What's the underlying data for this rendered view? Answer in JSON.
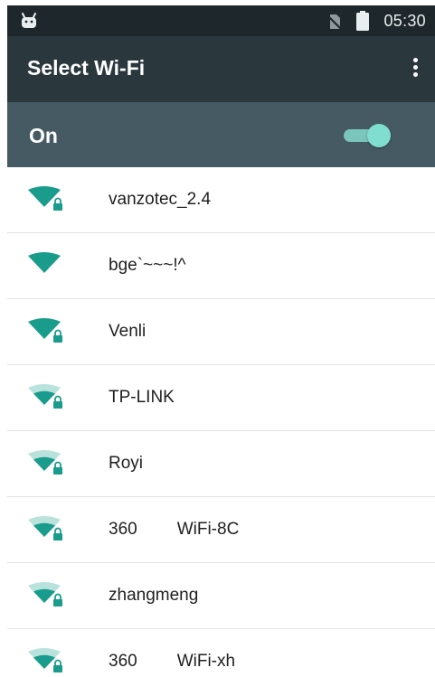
{
  "status_bar": {
    "time": "05:30",
    "icons": [
      "android-icon",
      "no-sim-icon",
      "battery-icon"
    ]
  },
  "app_bar": {
    "title": "Select Wi-Fi",
    "menu_icon": "overflow-menu-icon"
  },
  "wifi_switch": {
    "label": "On",
    "state": "on"
  },
  "colors": {
    "status_bar": "#1e272b",
    "app_bar": "#2a373d",
    "switch_bar": "#465a63",
    "accent": "#1a9c8c",
    "accent_light": "#b9e2dc"
  },
  "networks": [
    {
      "ssid": "vanzotec_2.4",
      "secured": true,
      "signal_bars": 4
    },
    {
      "ssid": "bge`~~~!^",
      "secured": false,
      "signal_bars": 4
    },
    {
      "ssid": "Venli",
      "secured": true,
      "signal_bars": 4
    },
    {
      "ssid": "TP-LINK",
      "secured": true,
      "signal_bars": 2
    },
    {
      "ssid": "Royi",
      "secured": true,
      "signal_bars": 2
    },
    {
      "ssid_prefix": "360",
      "ssid_suffix": "WiFi-8C",
      "secured": true,
      "signal_bars": 2
    },
    {
      "ssid": "zhangmeng",
      "secured": true,
      "signal_bars": 2
    },
    {
      "ssid_prefix": "360",
      "ssid_suffix": "WiFi-xh",
      "secured": true,
      "signal_bars": 2
    }
  ]
}
